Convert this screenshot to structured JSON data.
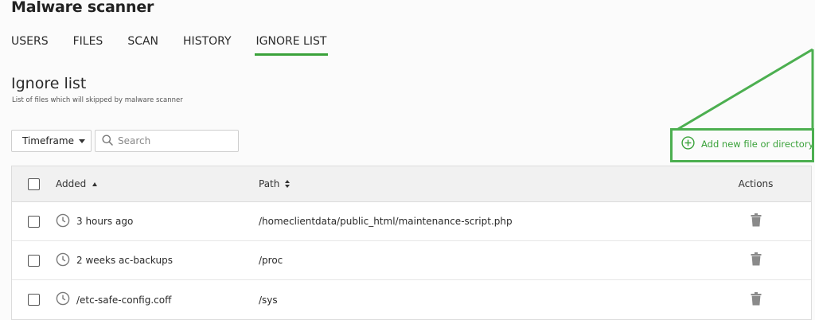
{
  "app": {
    "title": "Malware scanner"
  },
  "tabs": [
    {
      "label": "USERS",
      "active": false
    },
    {
      "label": "FILES",
      "active": false
    },
    {
      "label": "SCAN",
      "active": false
    },
    {
      "label": "HISTORY",
      "active": false
    },
    {
      "label": "IGNORE LIST",
      "active": true
    }
  ],
  "section": {
    "title": "Ignore list",
    "subtitle": "List of files which will skipped by malware scanner"
  },
  "toolbar": {
    "timeframe_label": "Timeframe",
    "search_placeholder": "Search",
    "add_label": "Add new file or directory"
  },
  "table": {
    "headers": {
      "added": "Added",
      "path": "Path",
      "actions": "Actions"
    },
    "rows": [
      {
        "added": "3 hours ago",
        "path": "/homeclientdata/public_html/maintenance-script.php"
      },
      {
        "added": "2 weeks ac-backups",
        "path": "/proc"
      },
      {
        "added": "/etc-safe-config.coff",
        "path": "/sys"
      }
    ]
  },
  "colors": {
    "accent": "#3aa23a",
    "annotation": "#4caf50"
  },
  "icons": {
    "clock": "clock-icon",
    "trash": "trash-icon",
    "add": "plus-circle-icon",
    "search": "search-icon"
  }
}
